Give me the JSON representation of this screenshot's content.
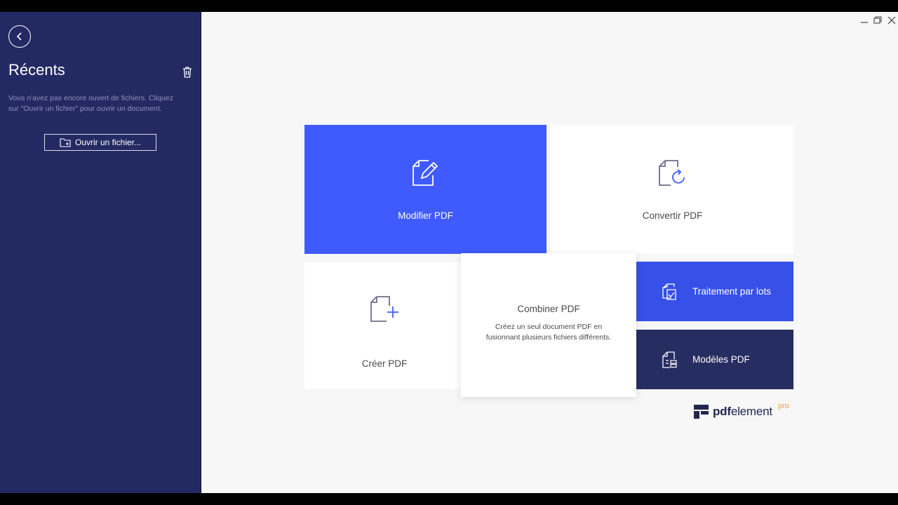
{
  "sidebar": {
    "title": "Récents",
    "empty_message": "Vous n'avez pas encore ouvert de fichiers. Cliquez sur \"Ouvrir un fichier\" pour ouvrir un document.",
    "open_file_label": "Ouvrir un fichier..."
  },
  "tiles": {
    "edit": {
      "label": "Modifier PDF",
      "icon": "edit-document-icon"
    },
    "convert": {
      "label": "Convertir PDF",
      "icon": "convert-document-icon"
    },
    "create": {
      "label": "Créer PDF",
      "icon": "create-document-icon"
    },
    "combine": {
      "label": "Combiner PDF",
      "description": "Créez un seul document PDF en fusionnant plusieurs fichiers différents."
    },
    "batch": {
      "label": "Traitement par lots",
      "icon": "batch-process-icon"
    },
    "templates": {
      "label": "Modèles PDF",
      "icon": "templates-icon"
    }
  },
  "brand": {
    "bold": "pdf",
    "rest": "element",
    "edition": "pro"
  },
  "colors": {
    "sidebar": "#232a63",
    "accent": "#3f5bfd",
    "batch": "#3650e8",
    "templates": "#262d61",
    "pro": "#f0a030"
  }
}
